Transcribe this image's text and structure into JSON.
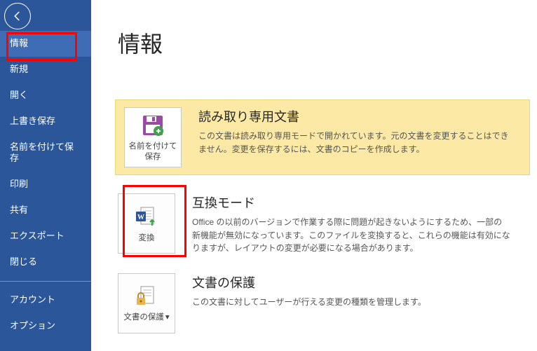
{
  "sidebar": {
    "items": [
      "情報",
      "新規",
      "開く",
      "上書き保存",
      "名前を付けて保存",
      "印刷",
      "共有",
      "エクスポート",
      "閉じる"
    ],
    "footer_items": [
      "アカウント",
      "オプション"
    ]
  },
  "page_title": "情報",
  "iconbtn": {
    "saveas": "名前を付けて保存",
    "convert": "変換",
    "protect": "文書の保護",
    "protect_caret": "▾"
  },
  "sections": {
    "readonly": {
      "title": "読み取り専用文書",
      "text": "この文書は読み取り専用モードで開かれています。元の文書を変更することはできません。変更を保存するには、文書のコピーを作成します。"
    },
    "compat": {
      "title": "互換モード",
      "text": "Office の以前のバージョンで作業する際に問題が起きないようにするため、一部の新機能が無効になっています。このファイルを変換すると、これらの機能は有効になりますが、レイアウトの変更が必要になる場合があります。"
    },
    "protect": {
      "title": "文書の保護",
      "text": "この文書に対してユーザーが行える変更の種類を管理します。"
    }
  }
}
